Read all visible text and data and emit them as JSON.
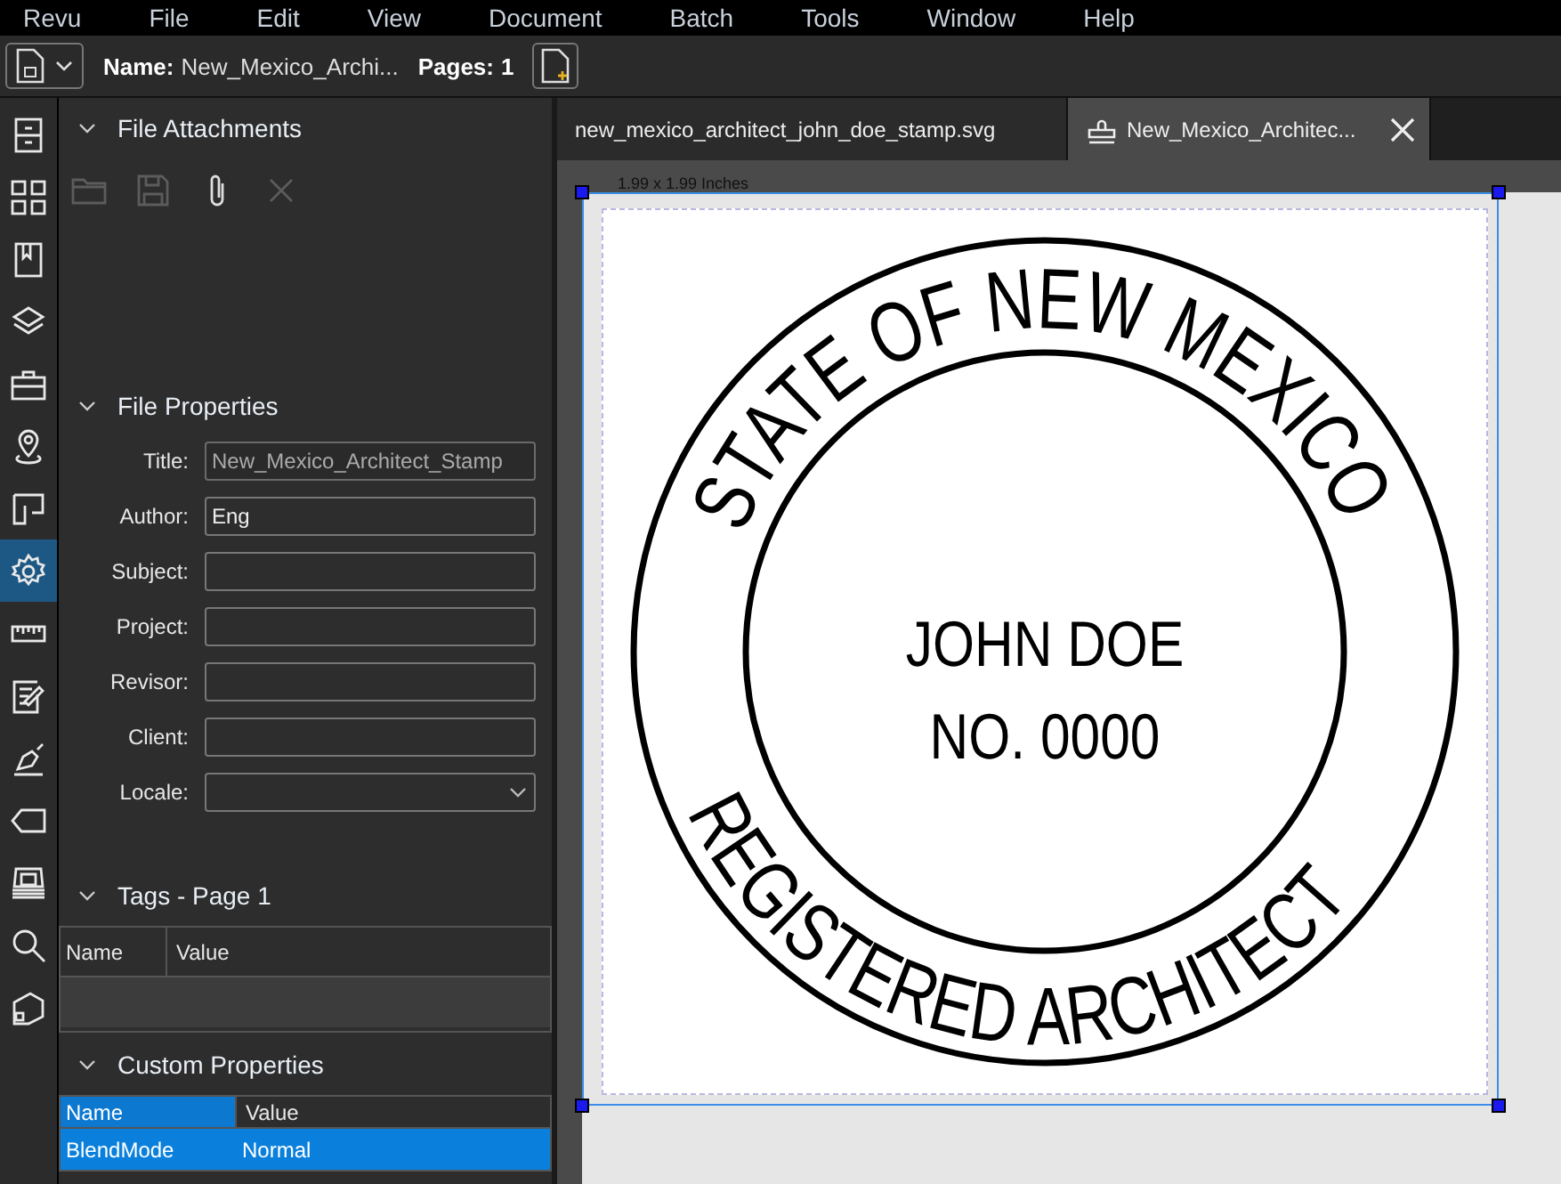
{
  "menu": [
    "Revu",
    "File",
    "Edit",
    "View",
    "Document",
    "Batch",
    "Tools",
    "Window",
    "Help"
  ],
  "toolbar": {
    "name_label": "Name:",
    "name_value": "New_Mexico_Archi...",
    "pages_label": "Pages:",
    "pages_value": "1"
  },
  "rail": [
    {
      "kind": "cabinet",
      "selected": false
    },
    {
      "kind": "grid",
      "selected": false
    },
    {
      "kind": "bookmark",
      "selected": false
    },
    {
      "kind": "layers",
      "selected": false
    },
    {
      "kind": "toolbox",
      "selected": false
    },
    {
      "kind": "pin",
      "selected": false
    },
    {
      "kind": "floorplan",
      "selected": false
    },
    {
      "kind": "gear",
      "selected": true
    },
    {
      "kind": "ruler",
      "selected": false
    },
    {
      "kind": "form",
      "selected": false
    },
    {
      "kind": "pen",
      "selected": false
    },
    {
      "kind": "tag",
      "selected": false
    },
    {
      "kind": "scanner",
      "selected": false
    },
    {
      "kind": "search",
      "selected": false
    },
    {
      "kind": "polygon",
      "selected": false
    }
  ],
  "attachments": {
    "title": "File Attachments",
    "tools": [
      {
        "kind": "folder",
        "disabled": true
      },
      {
        "kind": "save",
        "disabled": true
      },
      {
        "kind": "clip",
        "disabled": false
      },
      {
        "kind": "delete",
        "disabled": true
      }
    ]
  },
  "properties": {
    "title": "File Properties",
    "fields": [
      {
        "label": "Title:",
        "value": "New_Mexico_Architect_Stamp",
        "kind": "text",
        "disabled": true
      },
      {
        "label": "Author:",
        "value": "Eng",
        "kind": "text",
        "disabled": false
      },
      {
        "label": "Subject:",
        "kind": "text",
        "disabled": false
      },
      {
        "label": "Project:",
        "kind": "text",
        "disabled": false
      },
      {
        "label": "Revisor:",
        "kind": "text",
        "disabled": false
      },
      {
        "label": "Client:",
        "kind": "text",
        "disabled": false
      },
      {
        "label": "Locale:",
        "kind": "select",
        "disabled": false
      }
    ]
  },
  "tags": {
    "title": "Tags - Page 1",
    "columns": [
      "Name",
      "Value"
    ]
  },
  "custom": {
    "title": "Custom Properties",
    "columns": [
      "Name",
      "Value"
    ],
    "rows": [
      {
        "name": "BlendMode",
        "value": "Normal",
        "selected": true
      }
    ]
  },
  "tabs": [
    {
      "label": "new_mexico_architect_john_doe_stamp.svg",
      "selected": false
    },
    {
      "label": "New_Mexico_Architec...",
      "selected": true
    }
  ],
  "document": {
    "size_label": "1.99 x 1.99 Inches",
    "top_arc": "STATE OF NEW MEXICO",
    "bottom_arc": "REGISTERED ARCHITECT",
    "lines": [
      "JOHN DOE",
      "NO. 0000"
    ]
  }
}
